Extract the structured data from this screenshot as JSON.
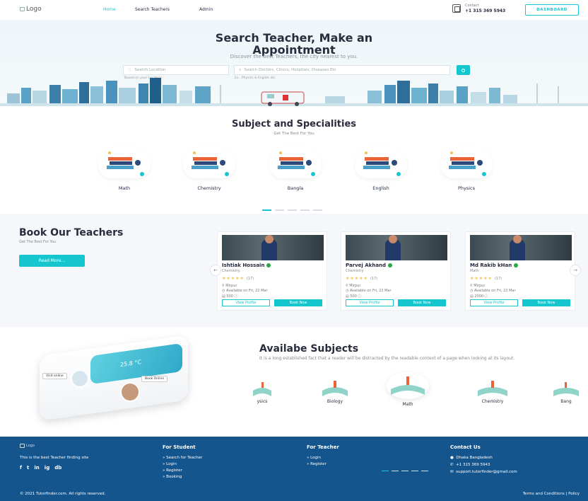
{
  "header": {
    "logo": "Logo",
    "nav": [
      "Home",
      "Search Teachers",
      "Admin"
    ],
    "contact_label": "Contact",
    "contact_phone": "+1 315 369 5943",
    "dashboard": "DASHBOARD"
  },
  "hero": {
    "title_line1": "Search Teacher, Make an",
    "title_line2": "Appointment",
    "subtitle": "Discover the best Teachers, the city nearest to you.",
    "location_placeholder": "Search Location",
    "location_hint": "Based on your Location",
    "search_placeholder": "Search Doctors, Clinics, Hospitals, Diseases Etc",
    "search_hint": "Ex : Physics & English etc"
  },
  "specialities": {
    "title": "Subject and Specialities",
    "subtitle": "Get The Best For You",
    "items": [
      "Math",
      "Chemistry",
      "Bangla",
      "English",
      "Physics"
    ]
  },
  "book": {
    "title": "Book Our Teachers",
    "subtitle": "Get The Best For You",
    "read_more": "Read More...",
    "cards": [
      {
        "name": "Ishtiak Hossain",
        "subject": "Chemistry",
        "rating_count": "(17)",
        "location": "Mirpur",
        "availability": "Available on Fri, 22 Mar",
        "fee": "500"
      },
      {
        "name": "Parvej Akhand",
        "subject": "Chemistry",
        "rating_count": "(17)",
        "location": "Mirpur",
        "availability": "Available on Fri, 22 Mar",
        "fee": "500"
      },
      {
        "name": "Md Rakib kHan",
        "subject": "Math",
        "rating_count": "(17)",
        "location": "Mirpur",
        "availability": "Available on Fri, 22 Mar",
        "fee": "2000"
      }
    ],
    "view_profile": "View Profile",
    "book_now": "Book Now"
  },
  "available": {
    "title": "Availabe Subjects",
    "description": "It is a long established fact that a reader will be distracted by the readable content of a page when looking at its layout.",
    "items": [
      "ysics",
      "Biology",
      "Math",
      "Chemistry",
      "Bang"
    ],
    "chip_visit": "Visit online",
    "chip_book": "Book Online",
    "screen_value": "25.8 °C"
  },
  "footer": {
    "logo": "Logo",
    "tagline": "This is the best Teacher finding site",
    "student_heading": "For Student",
    "student_links": [
      "Search for Teacher",
      "Login",
      "Register",
      "Booking"
    ],
    "teacher_heading": "For Teacher",
    "teacher_links": [
      "Login",
      "Register"
    ],
    "contact_heading": "Contact Us",
    "address": "Dhaka Bangladesh",
    "phone": "+1 315 369 5943",
    "email": "support.tutorfinder@gmail.com",
    "copyright": "© 2021 Tutorfinder.com. All rights reserved.",
    "terms": "Terms and Conditions  |  Policy",
    "social": [
      "f",
      "t",
      "in",
      "ig",
      "db"
    ]
  },
  "colors": {
    "accent": "#15c6ce",
    "footer": "#15558d",
    "star": "#f4c150"
  }
}
